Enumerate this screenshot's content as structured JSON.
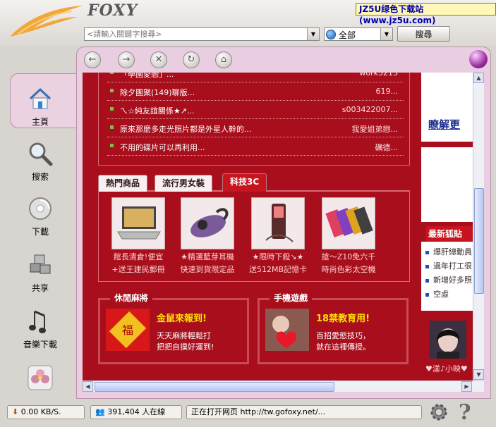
{
  "header": {
    "logo": "FOXY",
    "watermark": "JZ5U绿色下载站 (www.jz5u.com)",
    "search_placeholder": "<請輸入關鍵字搜尋>",
    "scope_value": "全部",
    "search_button": "搜尋"
  },
  "sidebar": {
    "items": [
      {
        "label": "主頁",
        "icon": "home-icon"
      },
      {
        "label": "搜索",
        "icon": "magnifier-icon"
      },
      {
        "label": "下載",
        "icon": "download-disc-icon"
      },
      {
        "label": "共享",
        "icon": "share-boxes-icon"
      },
      {
        "label": "音樂下載",
        "icon": "music-note-icon"
      },
      {
        "label": "",
        "icon": "flower-icon"
      }
    ]
  },
  "forum": {
    "rows": [
      {
        "title": "「學園愛戀」...",
        "user": "work5213"
      },
      {
        "title": "除夕團聚(149)聊版...",
        "user": "619..."
      },
      {
        "title": "ㄟ☆純友誼關係★↗...",
        "user": "s003422007..."
      },
      {
        "title": "原來那麼多走光照片都是外星人幹的...",
        "user": "我愛姐弟戀..."
      },
      {
        "title": "不用的碟片可以再利用...",
        "user": "礪德..."
      }
    ]
  },
  "tabs": [
    {
      "label": "熱門商品"
    },
    {
      "label": "流行男女裝"
    },
    {
      "label": "科技3C"
    }
  ],
  "products": [
    {
      "line1": "館長清倉!便宜",
      "line2": "+送王建民郵冊"
    },
    {
      "line1": "★精選藍芽耳機",
      "line2": "快速到貨限定品"
    },
    {
      "line1": "★限時下殺↘★",
      "line2": "送512MB記憶卡"
    },
    {
      "line1": "搶～Z10免六千",
      "line2": "時尚色彩太空機"
    }
  ],
  "games": {
    "casual": {
      "header": "休閒麻將",
      "title": "金鼠來報到!",
      "line1": "天天麻將輕鬆打",
      "line2": "把把自摸好運到!"
    },
    "mobile": {
      "header": "手機遊戲",
      "title": "18禁教育用!",
      "line1": "百招愛慾技巧，",
      "line2": "就在這裡傳授。"
    }
  },
  "right": {
    "more_link": "瞭解更",
    "news_header": "最新狐貼",
    "news": [
      "爆肝總動員",
      "過年打工很",
      "新增好多照",
      "空虛"
    ],
    "avatar_caption": "♥漾♪小映♥"
  },
  "statusbar": {
    "speed": "0.00 KB/S.",
    "online": "391,404 人在線",
    "status": "正在打开网页 http://tw.gofoxy.net/..."
  },
  "colors": {
    "page_red": "#a80e1c",
    "frame_pink": "#e9cde0",
    "accent_yellow": "#ffe000"
  }
}
